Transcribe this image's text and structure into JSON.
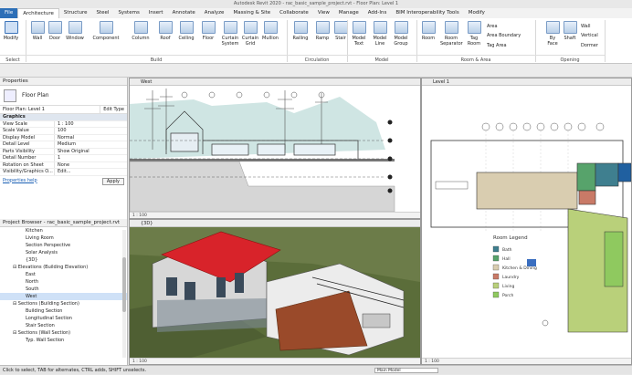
{
  "app": {
    "title": "Autodesk Revit 2020 - rac_basic_sample_project.rvt - Floor Plan: Level 1"
  },
  "ribbon": {
    "tabs": [
      "File",
      "Architecture",
      "Structure",
      "Steel",
      "Systems",
      "Insert",
      "Annotate",
      "Analyze",
      "Massing & Site",
      "Collaborate",
      "View",
      "Manage",
      "Add-Ins",
      "BIM Interoperability Tools",
      "Modify"
    ],
    "active_tab": "Architecture",
    "tools": [
      {
        "label": "Modify",
        "icon": "arrow-cursor-icon"
      },
      {
        "label": "Wall",
        "icon": "wall-icon"
      },
      {
        "label": "Door",
        "icon": "door-icon"
      },
      {
        "label": "Window",
        "icon": "window-icon"
      },
      {
        "label": "Component",
        "icon": "component-icon"
      },
      {
        "label": "Column",
        "icon": "column-icon"
      },
      {
        "label": "Roof",
        "icon": "roof-icon"
      },
      {
        "label": "Ceiling",
        "icon": "ceiling-icon"
      },
      {
        "label": "Floor",
        "icon": "floor-icon"
      },
      {
        "label": "Curtain System",
        "icon": "curtain-system-icon"
      },
      {
        "label": "Curtain Grid",
        "icon": "curtain-grid-icon"
      },
      {
        "label": "Mullion",
        "icon": "mullion-icon"
      },
      {
        "label": "Railing",
        "icon": "railing-icon"
      },
      {
        "label": "Ramp",
        "icon": "ramp-icon"
      },
      {
        "label": "Stair",
        "icon": "stair-icon"
      },
      {
        "label": "Model Text",
        "icon": "model-text-icon"
      },
      {
        "label": "Model Line",
        "icon": "model-line-icon"
      },
      {
        "label": "Model Group",
        "icon": "model-group-icon"
      },
      {
        "label": "Room",
        "icon": "room-icon"
      },
      {
        "label": "Room Separator",
        "icon": "room-separator-icon"
      },
      {
        "label": "Tag Room",
        "icon": "tag-room-icon"
      },
      {
        "label": "By Face",
        "icon": "by-face-icon"
      },
      {
        "label": "Shaft",
        "icon": "shaft-icon"
      }
    ],
    "small_tools": [
      "Area",
      "Area Boundary",
      "Tag Area",
      "Wall",
      "Vertical",
      "Dormer"
    ],
    "groups": [
      "Select",
      "Build",
      "Circulation",
      "Model",
      "Room & Area",
      "Opening"
    ]
  },
  "properties": {
    "title": "Properties",
    "type_name": "Floor Plan",
    "instance": "Floor Plan: Level 1",
    "edit_type": "Edit Type",
    "section": "Graphics",
    "rows": [
      {
        "k": "View Scale",
        "v": "1 : 100"
      },
      {
        "k": "Scale Value",
        "v": "100"
      },
      {
        "k": "Display Model",
        "v": "Normal"
      },
      {
        "k": "Detail Level",
        "v": "Medium"
      },
      {
        "k": "Parts Visibility",
        "v": "Show Original"
      },
      {
        "k": "Detail Number",
        "v": "1"
      },
      {
        "k": "Rotation on Sheet",
        "v": "None"
      },
      {
        "k": "Visibility/Graphics O...",
        "v": "Edit..."
      }
    ],
    "help": "Properties help",
    "apply": "Apply"
  },
  "browser": {
    "title": "Project Browser - rac_basic_sample_project.rvt",
    "items": [
      {
        "label": "Kitchen",
        "indent": 4
      },
      {
        "label": "Living Room",
        "indent": 4
      },
      {
        "label": "Section Perspective",
        "indent": 4
      },
      {
        "label": "Solar Analysis",
        "indent": 4
      },
      {
        "label": "{3D}",
        "indent": 4
      },
      {
        "label": "Elevations (Building Elevation)",
        "indent": 2
      },
      {
        "label": "East",
        "indent": 4
      },
      {
        "label": "North",
        "indent": 4
      },
      {
        "label": "South",
        "indent": 4
      },
      {
        "label": "West",
        "indent": 4,
        "selected": true
      },
      {
        "label": "Sections (Building Section)",
        "indent": 2
      },
      {
        "label": "Building Section",
        "indent": 4
      },
      {
        "label": "Longitudinal Section",
        "indent": 4
      },
      {
        "label": "Stair Section",
        "indent": 4
      },
      {
        "label": "Sections (Wall Section)",
        "indent": 2
      },
      {
        "label": "Typ. Wall Section",
        "indent": 4
      }
    ]
  },
  "views": {
    "west": {
      "title": "West",
      "scale": "1 : 100"
    },
    "threed": {
      "title": "{3D}",
      "scale": "1 : 100"
    },
    "level1": {
      "title": "Level 1",
      "scale": "1 : 100",
      "legend_title": "Room Legend",
      "legend": [
        {
          "name": "Bath",
          "color": "#3f7f8f"
        },
        {
          "name": "Hall",
          "color": "#57a36b"
        },
        {
          "name": "Kitchen & Dining",
          "color": "#d9cdb0"
        },
        {
          "name": "Laundry",
          "color": "#c97a67"
        },
        {
          "name": "Living",
          "color": "#b9d07a"
        },
        {
          "name": "Porch",
          "color": "#8fc95f"
        }
      ]
    }
  },
  "status": {
    "hint": "Click to select, TAB for alternates, CTRL adds, SHIFT unselects.",
    "model": "Main Model"
  }
}
